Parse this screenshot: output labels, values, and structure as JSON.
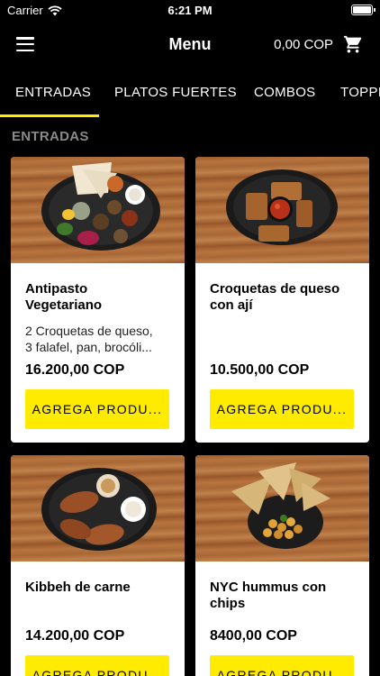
{
  "status": {
    "carrier": "Carrier",
    "time": "6:21 PM"
  },
  "header": {
    "title": "Menu",
    "cart_total": "0,00 COP"
  },
  "tabs": [
    {
      "label": "ENTRADAS",
      "active": true
    },
    {
      "label": "PLATOS FUERTES",
      "active": false
    },
    {
      "label": "COMBOS",
      "active": false
    },
    {
      "label": "TOPPINGS",
      "active": false
    }
  ],
  "section": {
    "title": "ENTRADAS"
  },
  "products": [
    {
      "name_line1": "Antipasto",
      "name_line2": "Vegetariano",
      "desc_line1": "2 Croquetas de queso,",
      "desc_line2": "3 falafel, pan, brocóli...",
      "price": "16.200,00 COP",
      "button": "AGREGA PRODU..."
    },
    {
      "name_line1": "Croquetas de queso",
      "name_line2": "con ají",
      "desc_line1": "",
      "desc_line2": "",
      "price": "10.500,00 COP",
      "button": "AGREGA PRODU..."
    },
    {
      "name_line1": "Kibbeh de carne",
      "name_line2": "",
      "desc_line1": "",
      "desc_line2": "",
      "price": "14.200,00 COP",
      "button": "AGREGA PRODU..."
    },
    {
      "name_line1": "NYC hummus con",
      "name_line2": "chips",
      "desc_line1": "",
      "desc_line2": "",
      "price": "8400,00 COP",
      "button": "AGREGA PRODU..."
    }
  ],
  "colors": {
    "background": "#000000",
    "accent": "#ffeb00",
    "section_title": "#8a8a8a"
  },
  "icons": [
    "wifi-icon",
    "battery-icon",
    "menu-icon",
    "cart-icon"
  ]
}
